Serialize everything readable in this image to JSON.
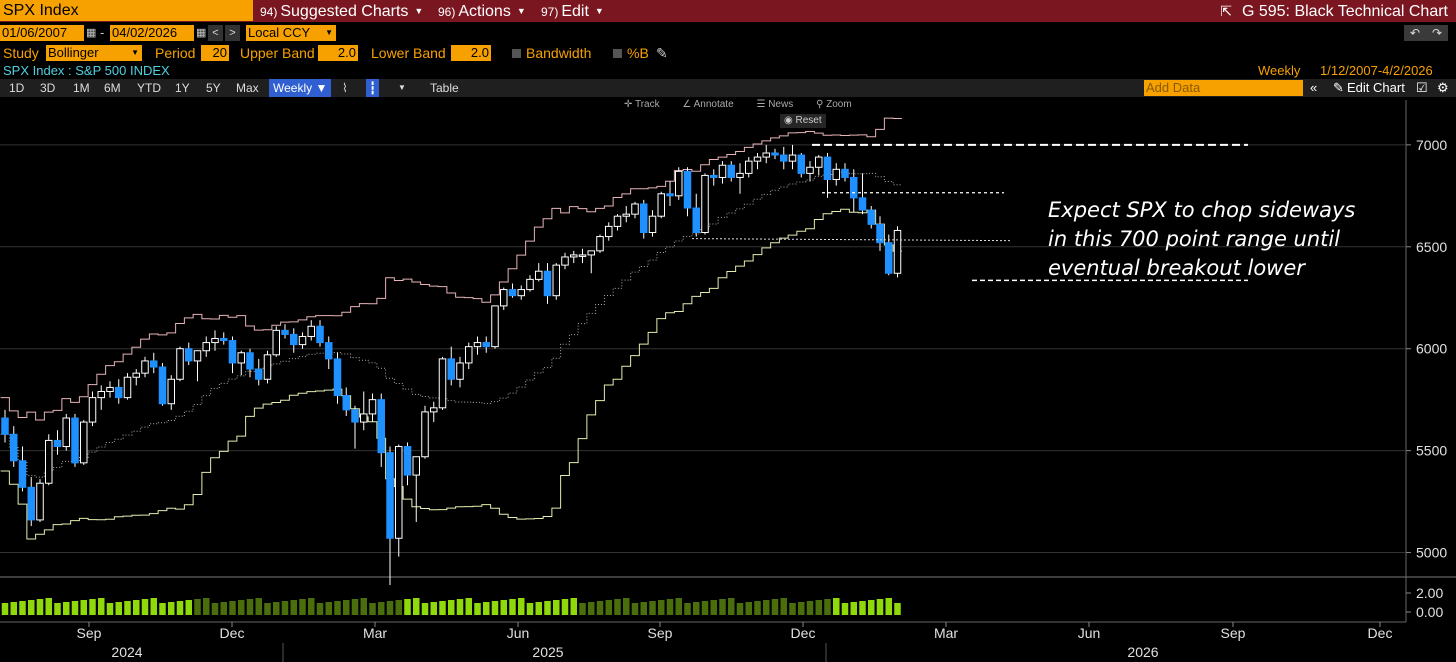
{
  "titlebar": {
    "ticker": "SPX Index",
    "menus": [
      {
        "num": "94)",
        "label": "Suggested Charts"
      },
      {
        "num": "96)",
        "label": "Actions"
      },
      {
        "num": "97)",
        "label": "Edit"
      }
    ],
    "right_title": "G 595: Black Technical Chart"
  },
  "dates": {
    "start": "01/06/2007",
    "separator": "-",
    "end": "04/02/2026",
    "currency": "Local CCY"
  },
  "study": {
    "label": "Study",
    "name": "Bollinger",
    "period_label": "Period",
    "period": "20",
    "upper_label": "Upper Band",
    "upper": "2.0",
    "lower_label": "Lower Band",
    "lower": "2.0",
    "bandwidth_label": "Bandwidth",
    "pctb_label": "%B"
  },
  "security": {
    "name": "SPX Index : S&P 500 INDEX",
    "frequency": "Weekly",
    "range": "1/12/2007-4/2/2026"
  },
  "toolbar": {
    "periods": [
      "1D",
      "3D",
      "1M",
      "6M",
      "YTD",
      "1Y",
      "5Y",
      "Max"
    ],
    "frequency": "Weekly ▼",
    "table": "Table",
    "add_data_placeholder": "Add Data",
    "edit_chart": "Edit Chart"
  },
  "chart_tools": {
    "track": "Track",
    "annotate": "Annotate",
    "news": "News",
    "zoom": "Zoom",
    "reset": "Reset"
  },
  "annotation": {
    "line1": "Expect SPX to chop sideways",
    "line2": "in this 700 point range until",
    "line3": "eventual breakout lower"
  },
  "colors": {
    "up": "#ffffff",
    "down": "#1e90ff",
    "upper_band": "#e8b4b8",
    "lower_band": "#e0f0b0",
    "mid_band": "#aaaaaa",
    "volume_light": "#8fd80a",
    "volume_dark": "#4a6e0c"
  },
  "chart_data": {
    "type": "candlestick",
    "y_axis": {
      "ticks": [
        5000,
        5500,
        6000,
        6500,
        7000
      ],
      "ylim": [
        4880,
        7220
      ]
    },
    "x_axis": {
      "months": [
        "Sep",
        "Dec",
        "Mar",
        "Jun",
        "Sep",
        "Dec",
        "Mar",
        "Jun",
        "Sep",
        "Dec"
      ],
      "years": [
        "2024",
        "2025",
        "2026"
      ]
    },
    "sub_axis": {
      "ticks": [
        "2.00",
        "0.00"
      ]
    },
    "candles": [
      [
        5660,
        5700,
        5540,
        5580
      ],
      [
        5580,
        5620,
        5420,
        5450
      ],
      [
        5450,
        5520,
        5300,
        5320
      ],
      [
        5320,
        5370,
        5130,
        5160
      ],
      [
        5160,
        5360,
        5150,
        5340
      ],
      [
        5340,
        5580,
        5330,
        5550
      ],
      [
        5550,
        5600,
        5480,
        5520
      ],
      [
        5520,
        5680,
        5500,
        5660
      ],
      [
        5660,
        5680,
        5420,
        5440
      ],
      [
        5440,
        5650,
        5430,
        5640
      ],
      [
        5640,
        5790,
        5620,
        5760
      ],
      [
        5760,
        5820,
        5700,
        5790
      ],
      [
        5790,
        5840,
        5760,
        5810
      ],
      [
        5810,
        5850,
        5730,
        5760
      ],
      [
        5760,
        5880,
        5750,
        5860
      ],
      [
        5860,
        5900,
        5820,
        5880
      ],
      [
        5880,
        5960,
        5860,
        5940
      ],
      [
        5940,
        5980,
        5880,
        5910
      ],
      [
        5910,
        5930,
        5720,
        5730
      ],
      [
        5730,
        5870,
        5700,
        5850
      ],
      [
        5850,
        6010,
        5840,
        6000
      ],
      [
        6000,
        6030,
        5920,
        5940
      ],
      [
        5940,
        5990,
        5840,
        5990
      ],
      [
        5990,
        6060,
        5960,
        6030
      ],
      [
        6030,
        6090,
        5990,
        6050
      ],
      [
        6050,
        6080,
        6020,
        6040
      ],
      [
        6040,
        6060,
        5880,
        5930
      ],
      [
        5930,
        5990,
        5870,
        5980
      ],
      [
        5980,
        6000,
        5860,
        5900
      ],
      [
        5900,
        5950,
        5820,
        5850
      ],
      [
        5850,
        5990,
        5830,
        5970
      ],
      [
        5970,
        6110,
        5960,
        6090
      ],
      [
        6090,
        6120,
        6050,
        6070
      ],
      [
        6070,
        6100,
        5980,
        6020
      ],
      [
        6020,
        6080,
        6000,
        6060
      ],
      [
        6060,
        6140,
        6040,
        6110
      ],
      [
        6110,
        6140,
        6010,
        6030
      ],
      [
        6030,
        6060,
        5900,
        5950
      ],
      [
        5950,
        5980,
        5730,
        5770
      ],
      [
        5770,
        5810,
        5670,
        5700
      ],
      [
        5700,
        5720,
        5510,
        5640
      ],
      [
        5640,
        5790,
        5600,
        5680
      ],
      [
        5680,
        5780,
        5640,
        5750
      ],
      [
        5750,
        5780,
        5420,
        5490
      ],
      [
        5490,
        5520,
        4840,
        5070
      ],
      [
        5070,
        5530,
        4980,
        5520
      ],
      [
        5520,
        5540,
        5330,
        5380
      ],
      [
        5380,
        5470,
        5150,
        5470
      ],
      [
        5470,
        5720,
        5460,
        5690
      ],
      [
        5690,
        5740,
        5640,
        5710
      ],
      [
        5710,
        5960,
        5700,
        5950
      ],
      [
        5950,
        6010,
        5820,
        5850
      ],
      [
        5850,
        5960,
        5810,
        5930
      ],
      [
        5930,
        6030,
        5900,
        6010
      ],
      [
        6010,
        6060,
        5970,
        6030
      ],
      [
        6030,
        6060,
        5980,
        6010
      ],
      [
        6010,
        6210,
        6000,
        6210
      ],
      [
        6210,
        6300,
        6190,
        6290
      ],
      [
        6290,
        6320,
        6250,
        6260
      ],
      [
        6260,
        6310,
        6240,
        6290
      ],
      [
        6290,
        6360,
        6280,
        6340
      ],
      [
        6340,
        6420,
        6330,
        6380
      ],
      [
        6380,
        6420,
        6220,
        6260
      ],
      [
        6260,
        6420,
        6240,
        6410
      ],
      [
        6410,
        6470,
        6390,
        6450
      ],
      [
        6450,
        6480,
        6420,
        6460
      ],
      [
        6460,
        6490,
        6420,
        6460
      ],
      [
        6460,
        6480,
        6370,
        6480
      ],
      [
        6480,
        6560,
        6470,
        6550
      ],
      [
        6550,
        6620,
        6530,
        6600
      ],
      [
        6600,
        6660,
        6580,
        6650
      ],
      [
        6650,
        6700,
        6620,
        6660
      ],
      [
        6660,
        6720,
        6640,
        6710
      ],
      [
        6710,
        6730,
        6540,
        6570
      ],
      [
        6570,
        6680,
        6550,
        6650
      ],
      [
        6650,
        6770,
        6640,
        6760
      ],
      [
        6760,
        6820,
        6700,
        6750
      ],
      [
        6750,
        6890,
        6730,
        6870
      ],
      [
        6870,
        6890,
        6650,
        6690
      ],
      [
        6690,
        6760,
        6550,
        6570
      ],
      [
        6570,
        6860,
        6560,
        6850
      ],
      [
        6850,
        6880,
        6800,
        6840
      ],
      [
        6840,
        6920,
        6810,
        6900
      ],
      [
        6900,
        6920,
        6820,
        6840
      ],
      [
        6840,
        6910,
        6760,
        6860
      ],
      [
        6860,
        6940,
        6840,
        6920
      ],
      [
        6920,
        6960,
        6880,
        6940
      ],
      [
        6940,
        7000,
        6910,
        6960
      ],
      [
        6960,
        6980,
        6930,
        6950
      ],
      [
        6950,
        6990,
        6880,
        6920
      ],
      [
        6920,
        7000,
        6880,
        6950
      ],
      [
        6950,
        6960,
        6840,
        6860
      ],
      [
        6860,
        6920,
        6820,
        6890
      ],
      [
        6890,
        6950,
        6850,
        6940
      ],
      [
        6940,
        6960,
        6740,
        6830
      ],
      [
        6830,
        6910,
        6800,
        6880
      ],
      [
        6880,
        6910,
        6820,
        6840
      ],
      [
        6840,
        6880,
        6670,
        6740
      ],
      [
        6740,
        6860,
        6660,
        6680
      ],
      [
        6680,
        6700,
        6590,
        6610
      ],
      [
        6610,
        6650,
        6480,
        6520
      ],
      [
        6520,
        6560,
        6360,
        6370
      ],
      [
        6370,
        6600,
        6350,
        6580
      ]
    ],
    "annotations": [
      "Expect SPX to chop sideways",
      "in this 700 point range until",
      "eventual breakout lower"
    ]
  }
}
